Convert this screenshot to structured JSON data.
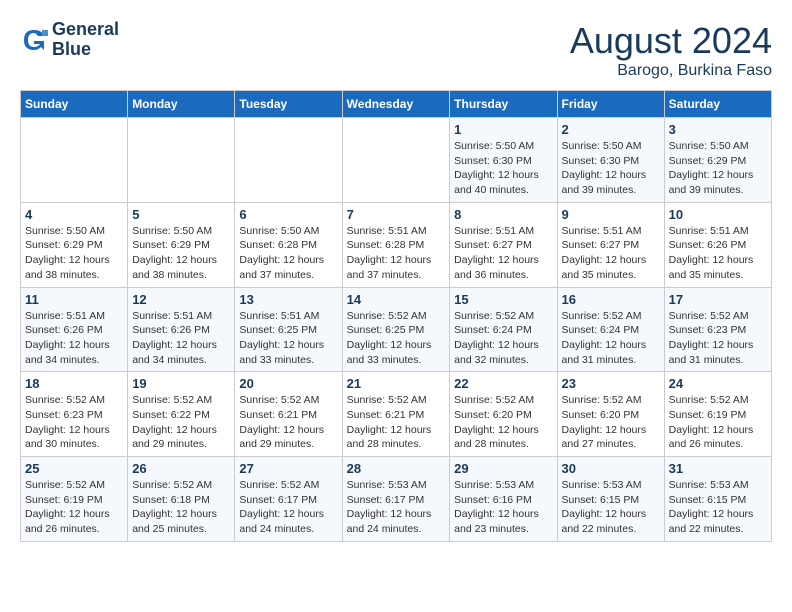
{
  "header": {
    "logo_line1": "General",
    "logo_line2": "Blue",
    "title": "August 2024",
    "subtitle": "Barogo, Burkina Faso"
  },
  "days_of_week": [
    "Sunday",
    "Monday",
    "Tuesday",
    "Wednesday",
    "Thursday",
    "Friday",
    "Saturday"
  ],
  "weeks": [
    [
      {
        "day": "",
        "info": ""
      },
      {
        "day": "",
        "info": ""
      },
      {
        "day": "",
        "info": ""
      },
      {
        "day": "",
        "info": ""
      },
      {
        "day": "1",
        "info": "Sunrise: 5:50 AM\nSunset: 6:30 PM\nDaylight: 12 hours\nand 40 minutes."
      },
      {
        "day": "2",
        "info": "Sunrise: 5:50 AM\nSunset: 6:30 PM\nDaylight: 12 hours\nand 39 minutes."
      },
      {
        "day": "3",
        "info": "Sunrise: 5:50 AM\nSunset: 6:29 PM\nDaylight: 12 hours\nand 39 minutes."
      }
    ],
    [
      {
        "day": "4",
        "info": "Sunrise: 5:50 AM\nSunset: 6:29 PM\nDaylight: 12 hours\nand 38 minutes."
      },
      {
        "day": "5",
        "info": "Sunrise: 5:50 AM\nSunset: 6:29 PM\nDaylight: 12 hours\nand 38 minutes."
      },
      {
        "day": "6",
        "info": "Sunrise: 5:50 AM\nSunset: 6:28 PM\nDaylight: 12 hours\nand 37 minutes."
      },
      {
        "day": "7",
        "info": "Sunrise: 5:51 AM\nSunset: 6:28 PM\nDaylight: 12 hours\nand 37 minutes."
      },
      {
        "day": "8",
        "info": "Sunrise: 5:51 AM\nSunset: 6:27 PM\nDaylight: 12 hours\nand 36 minutes."
      },
      {
        "day": "9",
        "info": "Sunrise: 5:51 AM\nSunset: 6:27 PM\nDaylight: 12 hours\nand 35 minutes."
      },
      {
        "day": "10",
        "info": "Sunrise: 5:51 AM\nSunset: 6:26 PM\nDaylight: 12 hours\nand 35 minutes."
      }
    ],
    [
      {
        "day": "11",
        "info": "Sunrise: 5:51 AM\nSunset: 6:26 PM\nDaylight: 12 hours\nand 34 minutes."
      },
      {
        "day": "12",
        "info": "Sunrise: 5:51 AM\nSunset: 6:26 PM\nDaylight: 12 hours\nand 34 minutes."
      },
      {
        "day": "13",
        "info": "Sunrise: 5:51 AM\nSunset: 6:25 PM\nDaylight: 12 hours\nand 33 minutes."
      },
      {
        "day": "14",
        "info": "Sunrise: 5:52 AM\nSunset: 6:25 PM\nDaylight: 12 hours\nand 33 minutes."
      },
      {
        "day": "15",
        "info": "Sunrise: 5:52 AM\nSunset: 6:24 PM\nDaylight: 12 hours\nand 32 minutes."
      },
      {
        "day": "16",
        "info": "Sunrise: 5:52 AM\nSunset: 6:24 PM\nDaylight: 12 hours\nand 31 minutes."
      },
      {
        "day": "17",
        "info": "Sunrise: 5:52 AM\nSunset: 6:23 PM\nDaylight: 12 hours\nand 31 minutes."
      }
    ],
    [
      {
        "day": "18",
        "info": "Sunrise: 5:52 AM\nSunset: 6:23 PM\nDaylight: 12 hours\nand 30 minutes."
      },
      {
        "day": "19",
        "info": "Sunrise: 5:52 AM\nSunset: 6:22 PM\nDaylight: 12 hours\nand 29 minutes."
      },
      {
        "day": "20",
        "info": "Sunrise: 5:52 AM\nSunset: 6:21 PM\nDaylight: 12 hours\nand 29 minutes."
      },
      {
        "day": "21",
        "info": "Sunrise: 5:52 AM\nSunset: 6:21 PM\nDaylight: 12 hours\nand 28 minutes."
      },
      {
        "day": "22",
        "info": "Sunrise: 5:52 AM\nSunset: 6:20 PM\nDaylight: 12 hours\nand 28 minutes."
      },
      {
        "day": "23",
        "info": "Sunrise: 5:52 AM\nSunset: 6:20 PM\nDaylight: 12 hours\nand 27 minutes."
      },
      {
        "day": "24",
        "info": "Sunrise: 5:52 AM\nSunset: 6:19 PM\nDaylight: 12 hours\nand 26 minutes."
      }
    ],
    [
      {
        "day": "25",
        "info": "Sunrise: 5:52 AM\nSunset: 6:19 PM\nDaylight: 12 hours\nand 26 minutes."
      },
      {
        "day": "26",
        "info": "Sunrise: 5:52 AM\nSunset: 6:18 PM\nDaylight: 12 hours\nand 25 minutes."
      },
      {
        "day": "27",
        "info": "Sunrise: 5:52 AM\nSunset: 6:17 PM\nDaylight: 12 hours\nand 24 minutes."
      },
      {
        "day": "28",
        "info": "Sunrise: 5:53 AM\nSunset: 6:17 PM\nDaylight: 12 hours\nand 24 minutes."
      },
      {
        "day": "29",
        "info": "Sunrise: 5:53 AM\nSunset: 6:16 PM\nDaylight: 12 hours\nand 23 minutes."
      },
      {
        "day": "30",
        "info": "Sunrise: 5:53 AM\nSunset: 6:15 PM\nDaylight: 12 hours\nand 22 minutes."
      },
      {
        "day": "31",
        "info": "Sunrise: 5:53 AM\nSunset: 6:15 PM\nDaylight: 12 hours\nand 22 minutes."
      }
    ]
  ]
}
